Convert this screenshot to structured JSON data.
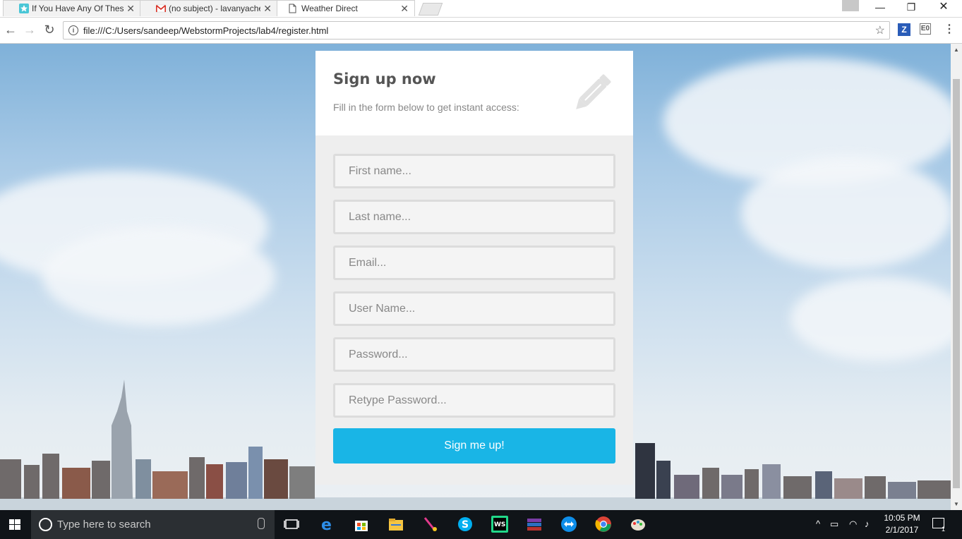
{
  "browser": {
    "tabs": [
      {
        "title": "If You Have Any Of These",
        "active": false,
        "favicon": "star-bookmark-icon"
      },
      {
        "title": "(no subject) - lavanyache",
        "active": false,
        "favicon": "gmail-icon"
      },
      {
        "title": "Weather Direct",
        "active": true,
        "favicon": "document-icon"
      }
    ],
    "url": "file:///C:/Users/sandeep/WebstormProjects/lab4/register.html",
    "extensions": [
      "Z",
      "E0"
    ]
  },
  "page": {
    "title": "Sign up now",
    "subtitle": "Fill in the form below to get instant access:",
    "header_icon": "pencil-icon",
    "fields": {
      "first_name": "First name...",
      "last_name": "Last name...",
      "email": "Email...",
      "username": "User Name...",
      "password": "Password...",
      "retype_password": "Retype Password..."
    },
    "submit_label": "Sign me up!",
    "accent_color": "#19b5e6"
  },
  "taskbar": {
    "search_placeholder": "Type here to search",
    "time": "10:05 PM",
    "date": "2/1/2017",
    "notification_count": "1"
  }
}
